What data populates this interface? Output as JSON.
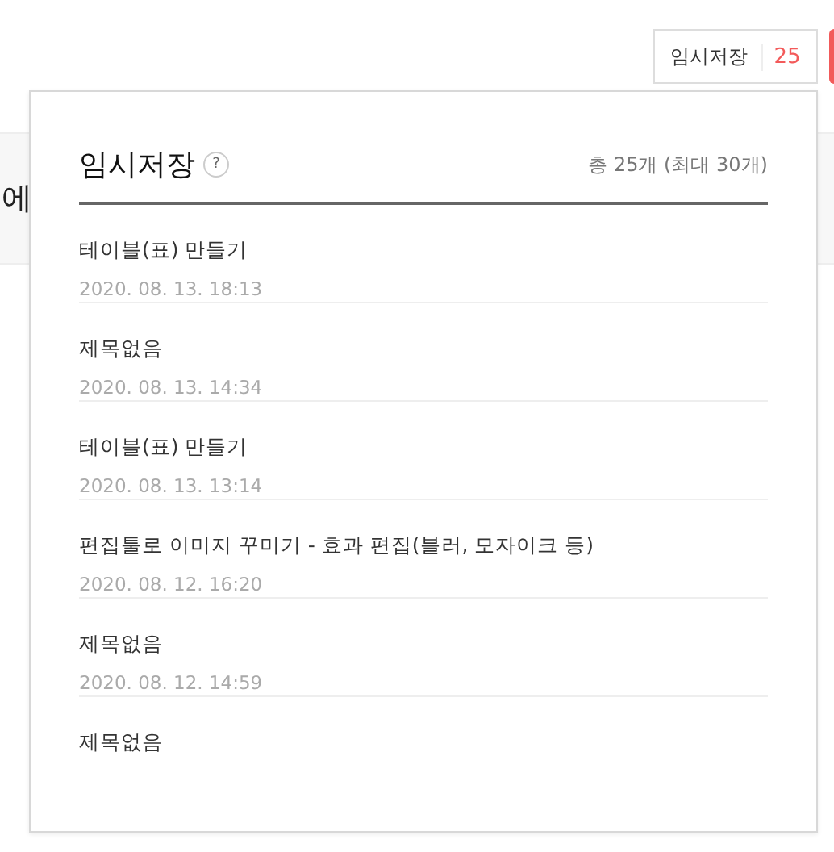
{
  "header": {
    "save_button": {
      "label": "임시저장",
      "count": "25"
    }
  },
  "background": {
    "heading_fragment": "에"
  },
  "drafts_panel": {
    "title": "임시저장",
    "help_icon": "?",
    "total": "총 25개 (최대 30개)",
    "items": [
      {
        "title": "테이블(표) 만들기",
        "date": "2020. 08. 13. 18:13"
      },
      {
        "title": "제목없음",
        "date": "2020. 08. 13. 14:34"
      },
      {
        "title": "테이블(표) 만들기",
        "date": "2020. 08. 13. 13:14"
      },
      {
        "title": "편집툴로 이미지 꾸미기 - 효과 편집(블러, 모자이크 등)",
        "date": "2020. 08. 12. 16:20"
      },
      {
        "title": "제목없음",
        "date": "2020. 08. 12. 14:59"
      },
      {
        "title": "제목없음"
      }
    ]
  }
}
